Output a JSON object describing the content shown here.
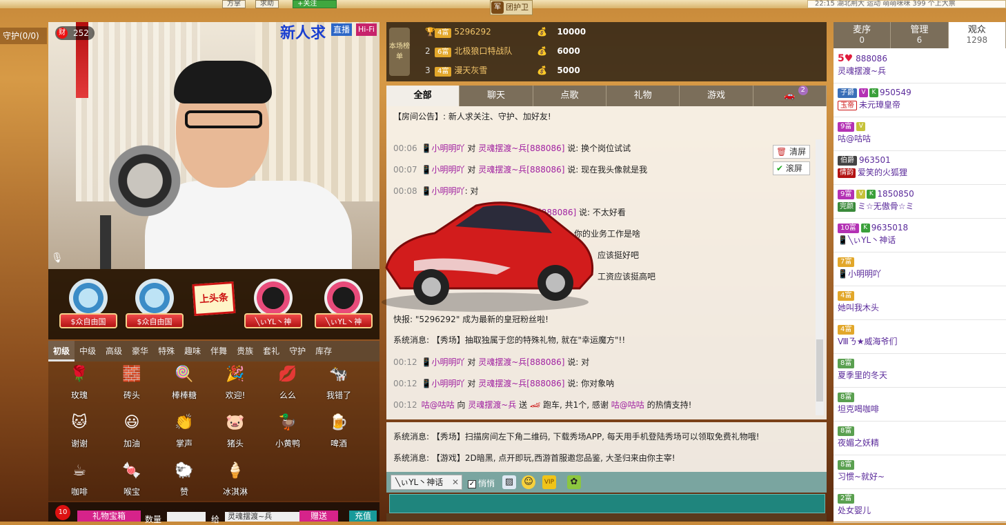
{
  "top": {
    "btn1": "方掌",
    "btn2": "求助",
    "follow": "+关注",
    "guard_team": "团护卫",
    "guard_icon_text": "军",
    "right_text": "22:15 湖北荆大 运动 萌萌咪咪 399 个上大票"
  },
  "guard_label": "守护(0/0)",
  "video": {
    "wealth_icon": "财",
    "wealth_value": "252",
    "title": "新人求",
    "live": "直播",
    "hifi": "Hi-Fi"
  },
  "promos": [
    {
      "label": "$众自由国"
    },
    {
      "label": "$众自由国"
    },
    {
      "label": "上头条"
    },
    {
      "label": "╲ぃYL丶神"
    },
    {
      "label": "╲ぃYL丶神"
    }
  ],
  "gift_tabs": [
    "初级",
    "中级",
    "高级",
    "豪华",
    "特殊",
    "趣味",
    "伴舞",
    "贵族",
    "套礼",
    "守护",
    "库存"
  ],
  "gifts": [
    {
      "name": "玫瑰",
      "glyph": "🌹"
    },
    {
      "name": "砖头",
      "glyph": "🧱"
    },
    {
      "name": "棒棒糖",
      "glyph": "🍭"
    },
    {
      "name": "欢迎!",
      "glyph": "🎉"
    },
    {
      "name": "么么",
      "glyph": "💋"
    },
    {
      "name": "我错了",
      "glyph": "🐄"
    },
    {
      "name": "谢谢",
      "glyph": "🐱"
    },
    {
      "name": "加油",
      "glyph": "😃"
    },
    {
      "name": "掌声",
      "glyph": "👏"
    },
    {
      "name": "猪头",
      "glyph": "🐷"
    },
    {
      "name": "小黄鸭",
      "glyph": "🦆"
    },
    {
      "name": "啤酒",
      "glyph": "🍺"
    },
    {
      "name": "咖啡",
      "glyph": "☕"
    },
    {
      "name": "喉宝",
      "glyph": "🍬"
    },
    {
      "name": "赞",
      "glyph": "🐑"
    },
    {
      "name": "冰淇淋",
      "glyph": "🍦"
    }
  ],
  "gift_bar": {
    "count": "10",
    "box": "礼物宝箱",
    "qty_label": "数量",
    "to_label": "给",
    "to_value": "灵魂摆渡~兵",
    "send": "赠送",
    "recharge": "充值"
  },
  "rank": {
    "board_label": "本场榜单",
    "rows": [
      {
        "no": "",
        "lvl": "4富",
        "name": "5296292",
        "value": "10000"
      },
      {
        "no": "2",
        "lvl": "6富",
        "name": "北极狼口特战队",
        "value": "6000"
      },
      {
        "no": "3",
        "lvl": "4富",
        "name": "漫天灰雪",
        "value": "5000"
      }
    ]
  },
  "chat_tabs": [
    "全部",
    "聊天",
    "点歌",
    "礼物",
    "游戏"
  ],
  "chat_tab_car_count": "2",
  "chat": {
    "notice": "【房间公告】: 新人求关注、守护、加好友!",
    "clear": "清屏",
    "scroll": "滚屏",
    "messages": [
      {
        "time": "00:06",
        "user": "小明明吖",
        "to": "灵魂摆渡~兵[888086]",
        "text": "换个岗位试试"
      },
      {
        "time": "00:07",
        "user": "小明明吖",
        "to": "灵魂摆渡~兵[888086]",
        "text": "现在我头像就是我"
      },
      {
        "time": "00:08",
        "user": "小明明吖",
        "to": "",
        "text": "对"
      },
      {
        "time": "",
        "user": "",
        "to": "[888086]",
        "text": "不太好看"
      },
      {
        "time": "",
        "user": "",
        "to": "",
        "text": "你的业务工作是啥"
      },
      {
        "time": "",
        "user": "",
        "to": "",
        "text": "应该挺好吧"
      },
      {
        "time": "",
        "user": "",
        "to": "",
        "text": "工资应该挺高吧"
      }
    ],
    "flash": "快报: \"5296292\" 成为最新的皇冠粉丝啦!",
    "sys1": "系统消息: 【秀场】抽取独属于您的特殊礼物, 就在\"幸运魔方\"!!",
    "late": [
      {
        "time": "00:12",
        "user": "小明明吖",
        "to": "灵魂摆渡~兵[888086]",
        "text": "对"
      },
      {
        "time": "00:12",
        "user": "小明明吖",
        "to": "灵魂摆渡~兵[888086]",
        "text": "你对象呐"
      }
    ],
    "gift_msg": {
      "time": "00:12",
      "user": "咕@咕咕",
      "to": "灵魂摆渡~兵",
      "text": "跑车, 共1个, 感谢",
      "thanks_user": "咕@咕咕",
      "tail": "的热情支持!"
    }
  },
  "sys_msgs": [
    "系统消息: 【秀场】扫描房间左下角二维码, 下载秀场APP, 每天用手机登陆秀场可以领取免费礼物哦!",
    "系统消息: 【游戏】2D暗黑, 点开即玩,西游首服邀您品鉴, 大圣归来由你主宰!"
  ],
  "input": {
    "to": "╲ぃYL丶神话",
    "quiet": "悄悄",
    "vip": "VIP"
  },
  "users": {
    "tabs": [
      {
        "label": "麦序",
        "count": "0"
      },
      {
        "label": "管理",
        "count": "6"
      },
      {
        "label": "观众",
        "count": "1298"
      }
    ],
    "rows": [
      {
        "lvl": "5",
        "id": "888086",
        "name": "灵魂摆渡~兵",
        "color": "#e01b3c"
      },
      {
        "lvl": "子爵",
        "id": "950549",
        "tag": "玉帝",
        "name": "未元璋皇帝",
        "color": "#3a6fb8"
      },
      {
        "lvl": "9富",
        "id": "",
        "name": "咕@咕咕",
        "color": "#b432b4"
      },
      {
        "lvl": "伯爵",
        "id": "963501",
        "tag": "情韵",
        "name": "爱笑的火狐狸",
        "color": "#444"
      },
      {
        "lvl": "9富",
        "id": "1850850",
        "tag": "完颜",
        "name": "ミ☆无傲骨☆ミ",
        "color": "#b432b4"
      },
      {
        "lvl": "10富",
        "id": "9635018",
        "name": "╲ぃYL丶神话",
        "color": "#b432b4"
      },
      {
        "lvl": "7富",
        "id": "",
        "name": "小明明吖",
        "color": "#e2a72a"
      },
      {
        "lvl": "4富",
        "id": "",
        "name": "她叫我木头",
        "color": "#e2a72a"
      },
      {
        "lvl": "4富",
        "id": "",
        "name": "Ⅷㄋ★威海爷们",
        "color": "#e2a72a"
      },
      {
        "lvl": "8富",
        "id": "",
        "name": "夏季里的冬天",
        "color": "#5aa050"
      },
      {
        "lvl": "8富",
        "id": "",
        "name": "坦克喝咖啡",
        "color": "#5aa050"
      },
      {
        "lvl": "8富",
        "id": "",
        "name": "夜媚之妖精",
        "color": "#5aa050"
      },
      {
        "lvl": "8富",
        "id": "",
        "name": "习惯~就好~",
        "color": "#5aa050"
      },
      {
        "lvl": "2富",
        "id": "",
        "name": "处女婴儿",
        "color": "#5aa050"
      }
    ]
  }
}
